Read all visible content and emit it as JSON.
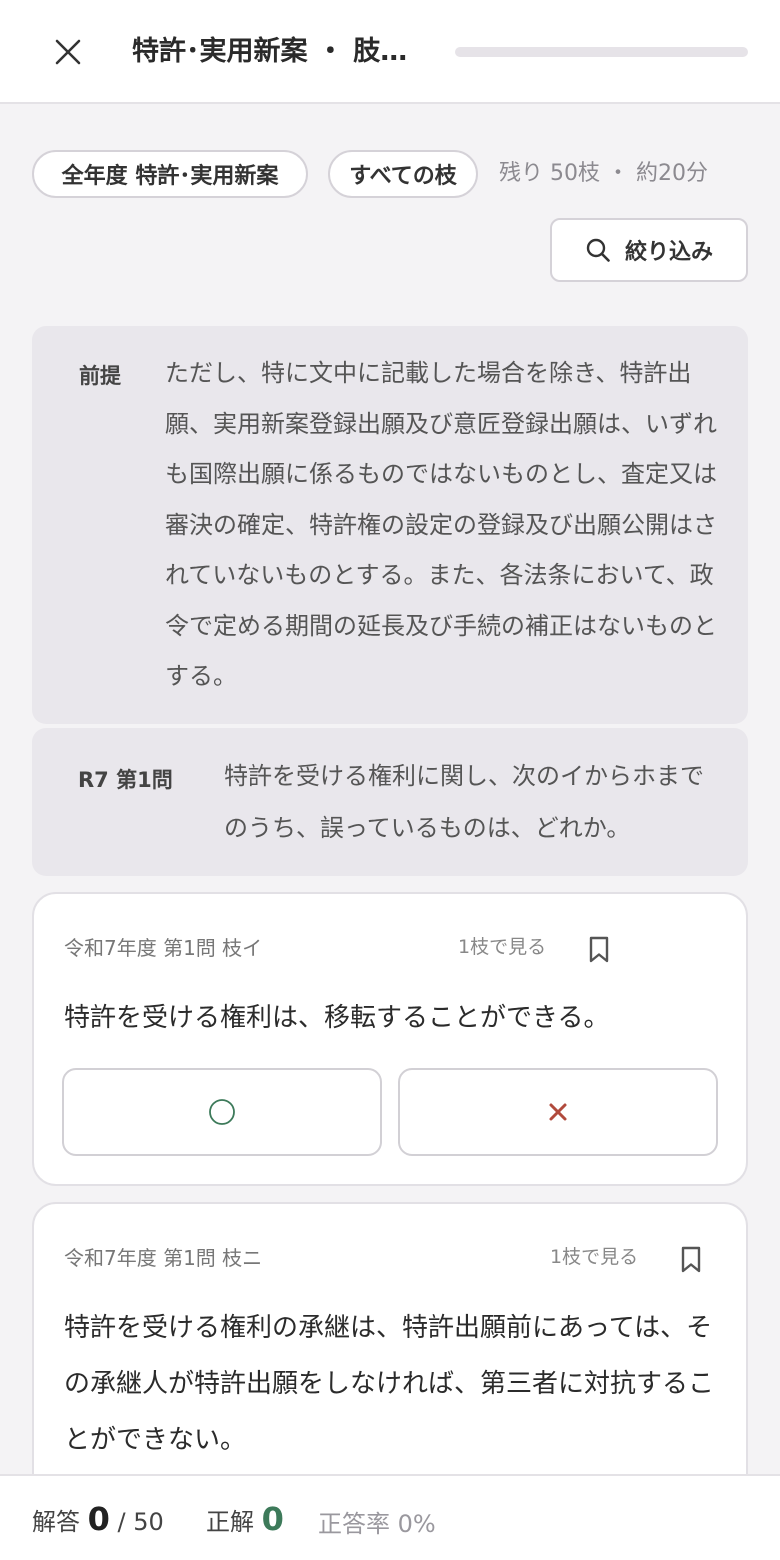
{
  "header": {
    "title": "特許･実用新案 ・ 肢…",
    "progress": 0
  },
  "filters": {
    "year_chip": "全年度 特許･実用新案",
    "branch_chip": "すべての枝",
    "remaining": "残り 50枝 ・ 約20分",
    "filter_button": "絞り込み"
  },
  "premise": {
    "label": "前提",
    "text": "ただし、特に文中に記載した場合を除き、特許出願、実用新案登録出願及び意匠登録出願は、いずれも国際出願に係るものではないものとし、査定又は審決の確定、特許権の設定の登録及び出願公開はされていないものとする。また、各法条において、政令で定める期間の延長及び手続の補正はないものとする。"
  },
  "question": {
    "label": "R7 第1問",
    "text": "特許を受ける権利に関し、次のイからホまでのうち、誤っているものは、どれか。"
  },
  "cards": [
    {
      "meta": "令和7年度 第1問 枝イ",
      "view_label": "1枝で見る",
      "text": "特許を受ける権利は、移転することができる。"
    },
    {
      "meta": "令和7年度 第1問 枝ニ",
      "view_label": "1枝で見る",
      "text": "特許を受ける権利の承継は、特許出願前にあっては、その承継人が特許出願をしなければ、第三者に対抗することができない。"
    }
  ],
  "stats": {
    "answered_label": "解答",
    "answered_value": "0",
    "answered_total": "/ 50",
    "correct_label": "正解",
    "correct_value": "0",
    "rate_label": "正答率 0%"
  },
  "colors": {
    "correct_green": "#3d7a5a",
    "wrong_red": "#b14a3c"
  }
}
